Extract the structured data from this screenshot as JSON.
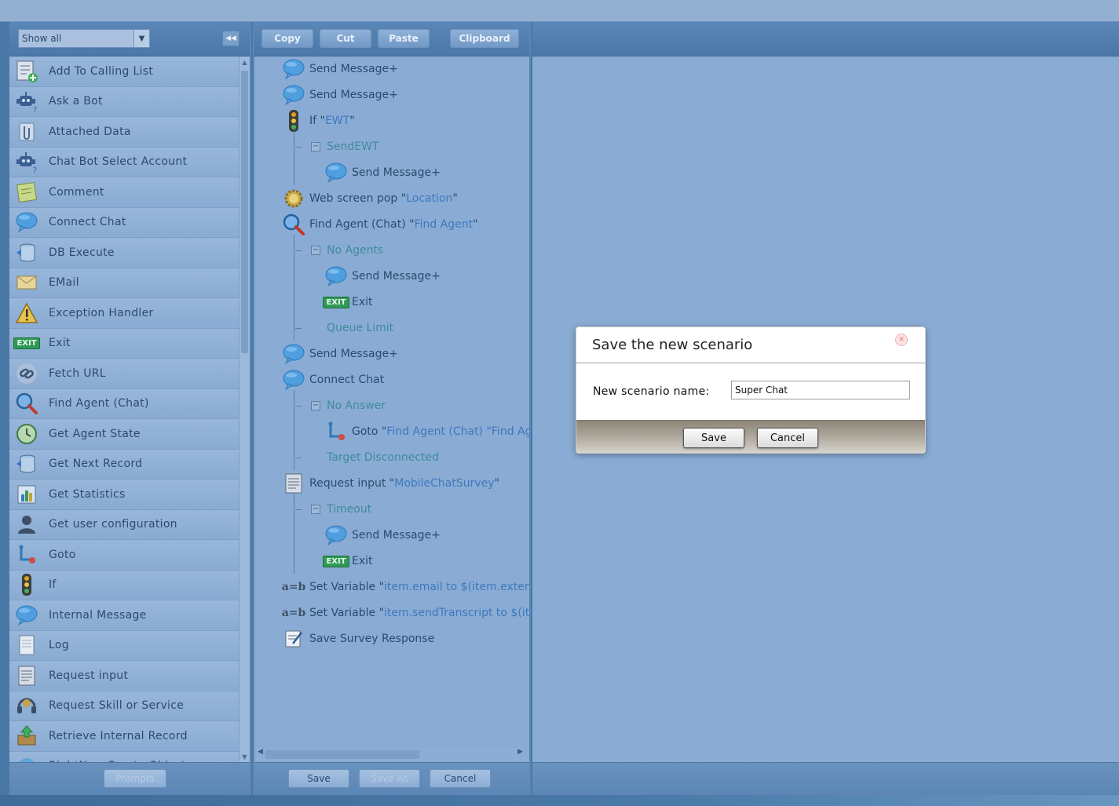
{
  "palette": {
    "filter_value": "Show all",
    "items": [
      {
        "label": "Add To Calling List",
        "icon": "calling-list-icon"
      },
      {
        "label": "Ask a Bot",
        "icon": "bot-question-icon"
      },
      {
        "label": "Attached Data",
        "icon": "paperclip-icon"
      },
      {
        "label": "Chat Bot Select Account",
        "icon": "bot-cursor-icon"
      },
      {
        "label": "Comment",
        "icon": "note-icon"
      },
      {
        "label": "Connect Chat",
        "icon": "chat-bubbles-icon"
      },
      {
        "label": "DB Execute",
        "icon": "database-icon"
      },
      {
        "label": "EMail",
        "icon": "envelope-icon"
      },
      {
        "label": "Exception Handler",
        "icon": "warning-icon"
      },
      {
        "label": "Exit",
        "icon": "exit-icon"
      },
      {
        "label": "Fetch URL",
        "icon": "link-icon"
      },
      {
        "label": "Find Agent (Chat)",
        "icon": "magnifier-icon"
      },
      {
        "label": "Get Agent State",
        "icon": "clock-icon"
      },
      {
        "label": "Get Next Record",
        "icon": "database-next-icon"
      },
      {
        "label": "Get Statistics",
        "icon": "bar-chart-icon"
      },
      {
        "label": "Get user configuration",
        "icon": "user-icon"
      },
      {
        "label": "Goto",
        "icon": "goto-icon"
      },
      {
        "label": "If",
        "icon": "traffic-light-icon"
      },
      {
        "label": "Internal Message",
        "icon": "speech-bubble-icon"
      },
      {
        "label": "Log",
        "icon": "log-icon"
      },
      {
        "label": "Request input",
        "icon": "form-icon"
      },
      {
        "label": "Request Skill or Service",
        "icon": "headset-icon"
      },
      {
        "label": "Retrieve Internal Record",
        "icon": "upload-box-icon"
      },
      {
        "label": "RightNow Create Object",
        "icon": "rightnow-icon"
      }
    ],
    "prompts_label": "Prompts"
  },
  "toolbar": {
    "copy": "Copy",
    "cut": "Cut",
    "paste": "Paste",
    "clipboard": "Clipboard"
  },
  "tree": {
    "nodes": [
      {
        "text": "Send Message+",
        "arg": "",
        "icon": "speech-bubble-icon"
      },
      {
        "text": "Send Message+",
        "arg": "",
        "icon": "speech-bubble-icon"
      },
      {
        "text": "If \"",
        "arg": "EWT",
        "tail": "\"",
        "icon": "traffic-light-icon"
      },
      {
        "text": "SendEWT",
        "branch": true
      },
      {
        "text": "Send Message+",
        "arg": "",
        "icon": "speech-bubble-icon"
      },
      {
        "text": "Web screen pop \"",
        "arg": "Location",
        "tail": "\"",
        "icon": "gear-icon"
      },
      {
        "text": "Find Agent (Chat) \"",
        "arg": "Find Agent",
        "tail": "\"",
        "icon": "magnifier-icon"
      },
      {
        "text": "No Agents",
        "branch": true
      },
      {
        "text": "Send Message+",
        "arg": "",
        "icon": "speech-bubble-icon"
      },
      {
        "text": "Exit",
        "arg": "",
        "icon": "exit-icon"
      },
      {
        "text": "Queue Limit",
        "branch": true
      },
      {
        "text": "Send Message+",
        "arg": "",
        "icon": "speech-bubble-icon"
      },
      {
        "text": "Connect Chat",
        "arg": "",
        "icon": "chat-bubbles-icon"
      },
      {
        "text": "No Answer",
        "branch": true
      },
      {
        "text": "Goto \"",
        "arg": "Find Agent (Chat) \"Find Ag",
        "tail": "",
        "icon": "goto-icon"
      },
      {
        "text": "Target Disconnected",
        "branch": true
      },
      {
        "text": "Request input \"",
        "arg": "MobileChatSurvey",
        "tail": "\"",
        "icon": "form-icon"
      },
      {
        "text": "Timeout",
        "branch": true
      },
      {
        "text": "Send Message+",
        "arg": "",
        "icon": "speech-bubble-icon"
      },
      {
        "text": "Exit",
        "arg": "",
        "icon": "exit-icon"
      },
      {
        "text": "Set Variable \"",
        "arg": "item.email to $(item.extern",
        "tail": "",
        "icon": "ab-icon"
      },
      {
        "text": "Set Variable \"",
        "arg": "item.sendTranscript to $(it",
        "tail": "",
        "icon": "ab-icon"
      },
      {
        "text": "Save Survey Response",
        "arg": "",
        "icon": "survey-icon"
      }
    ]
  },
  "middle_footer": {
    "save": "Save",
    "save_as": "Save As",
    "cancel": "Cancel"
  },
  "modal": {
    "title": "Save the new scenario",
    "field_label": "New scenario name:",
    "field_value": "Super Chat",
    "save": "Save",
    "cancel": "Cancel"
  },
  "icons": {
    "exit_text": "EXIT",
    "ab_text": "a=b"
  }
}
